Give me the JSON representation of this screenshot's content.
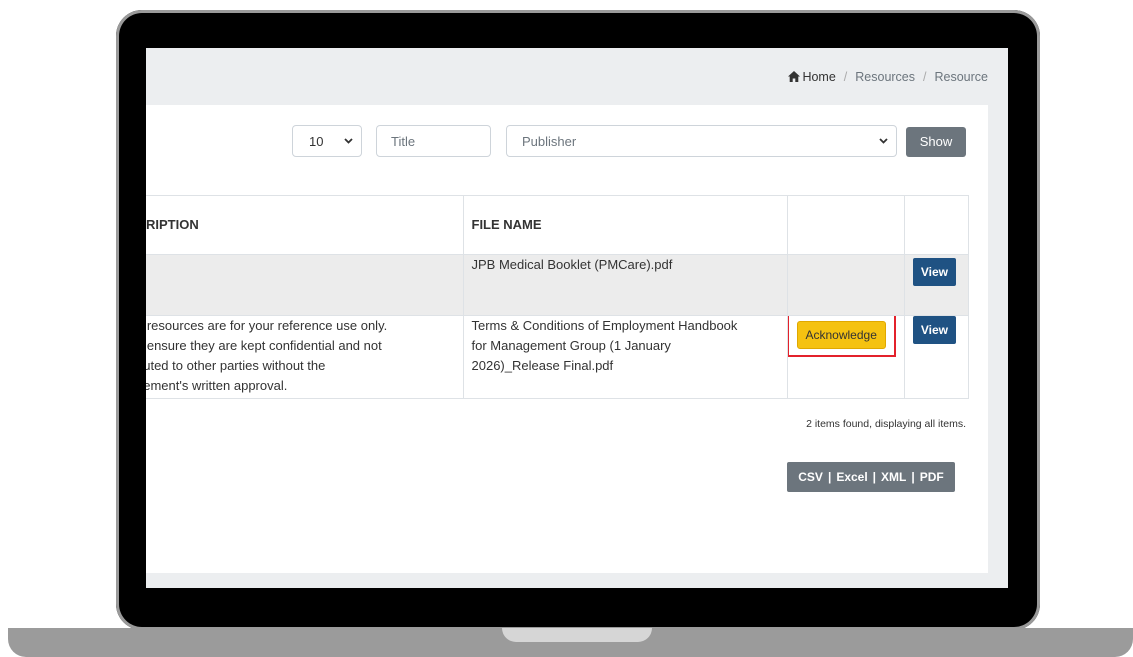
{
  "breadcrumb": {
    "items": [
      "Home",
      "Resources",
      "Resource"
    ],
    "separator": "/"
  },
  "filters": {
    "page_size": "10",
    "title_placeholder": "Title",
    "publisher_placeholder": "Publisher",
    "show_label": "Show"
  },
  "table": {
    "headers": {
      "description": "RIPTION",
      "file_name": "FILE NAME"
    },
    "rows": [
      {
        "description_lines": [],
        "file_name_lines": [
          "JPB Medical Booklet (PMCare).pdf"
        ],
        "acknowledge_label": "",
        "view_label": "View"
      },
      {
        "description_lines": [
          "e resources are for your reference use only.",
          "e ensure they are kept confidential and not",
          "buted to other parties without the",
          "gement's written approval."
        ],
        "file_name_lines": [
          "Terms & Conditions of Employment Handbook",
          "for Management Group (1 January",
          "2026)_Release Final.pdf"
        ],
        "acknowledge_label": "Acknowledge",
        "view_label": "View"
      }
    ]
  },
  "summary": "2 items found, displaying all items.",
  "export": {
    "csv": "CSV",
    "excel": "Excel",
    "xml": "XML",
    "pdf": "PDF",
    "separator": "|"
  },
  "colors": {
    "view_button": "#1f5283",
    "acknowledge_button": "#f5c211",
    "highlight_frame": "#e3212b",
    "show_button": "#6c757d"
  }
}
